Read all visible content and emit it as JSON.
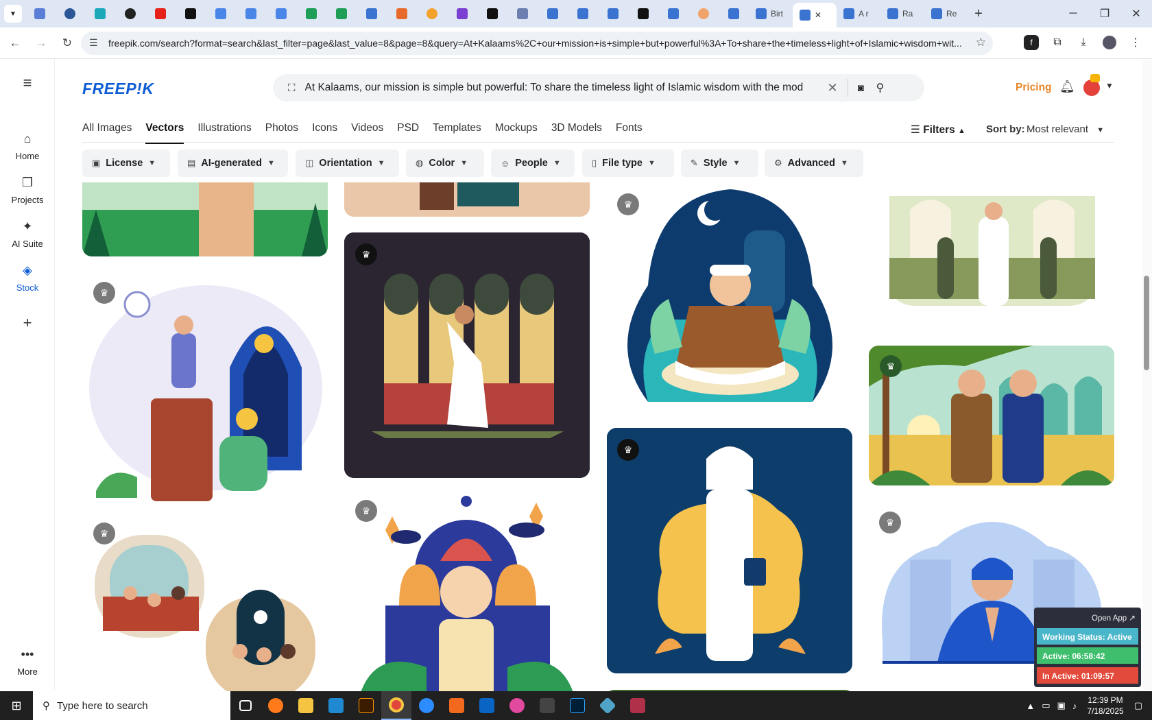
{
  "browser": {
    "tab_titles": [
      "Birt",
      "A r",
      "Ra",
      "Re"
    ],
    "url": "freepik.com/search?format=search&last_filter=page&last_value=8&page=8&query=At+Kalaams%2C+our+mission+is+simple+but+powerful%3A+To+share+the+timeless+light+of+Islamic+wisdom+wit..."
  },
  "rail": {
    "home": "Home",
    "projects": "Projects",
    "ai_suite": "AI Suite",
    "stock": "Stock",
    "more": "More"
  },
  "header": {
    "logo": "FREEP!K",
    "search_query": "At Kalaams, our mission is simple but powerful: To share the timeless light of Islamic wisdom with the mod",
    "pricing": "Pricing"
  },
  "categories": [
    "All Images",
    "Vectors",
    "Illustrations",
    "Photos",
    "Icons",
    "Videos",
    "PSD",
    "Templates",
    "Mockups",
    "3D Models",
    "Fonts"
  ],
  "active_category": "Vectors",
  "sort": {
    "filters_label": "Filters",
    "sort_label": "Sort by:",
    "sort_value": "Most relevant"
  },
  "chips": [
    "License",
    "AI-generated",
    "Orientation",
    "Color",
    "People",
    "File type",
    "Style",
    "Advanced"
  ],
  "tracker": {
    "open_app": "Open App ↗",
    "status": "Working Status: Active",
    "active": "Active: 06:58:42",
    "inactive": "In Active: 01:09:57"
  },
  "taskbar": {
    "search_placeholder": "Type here to search",
    "time": "12:39 PM",
    "date": "7/18/2025"
  },
  "colors": {
    "brand": "#0f5ed5",
    "pricing": "#e8852a",
    "status_active": "#49b6c9",
    "active_green": "#3fbf6e",
    "inactive_red": "#e24a3b"
  }
}
